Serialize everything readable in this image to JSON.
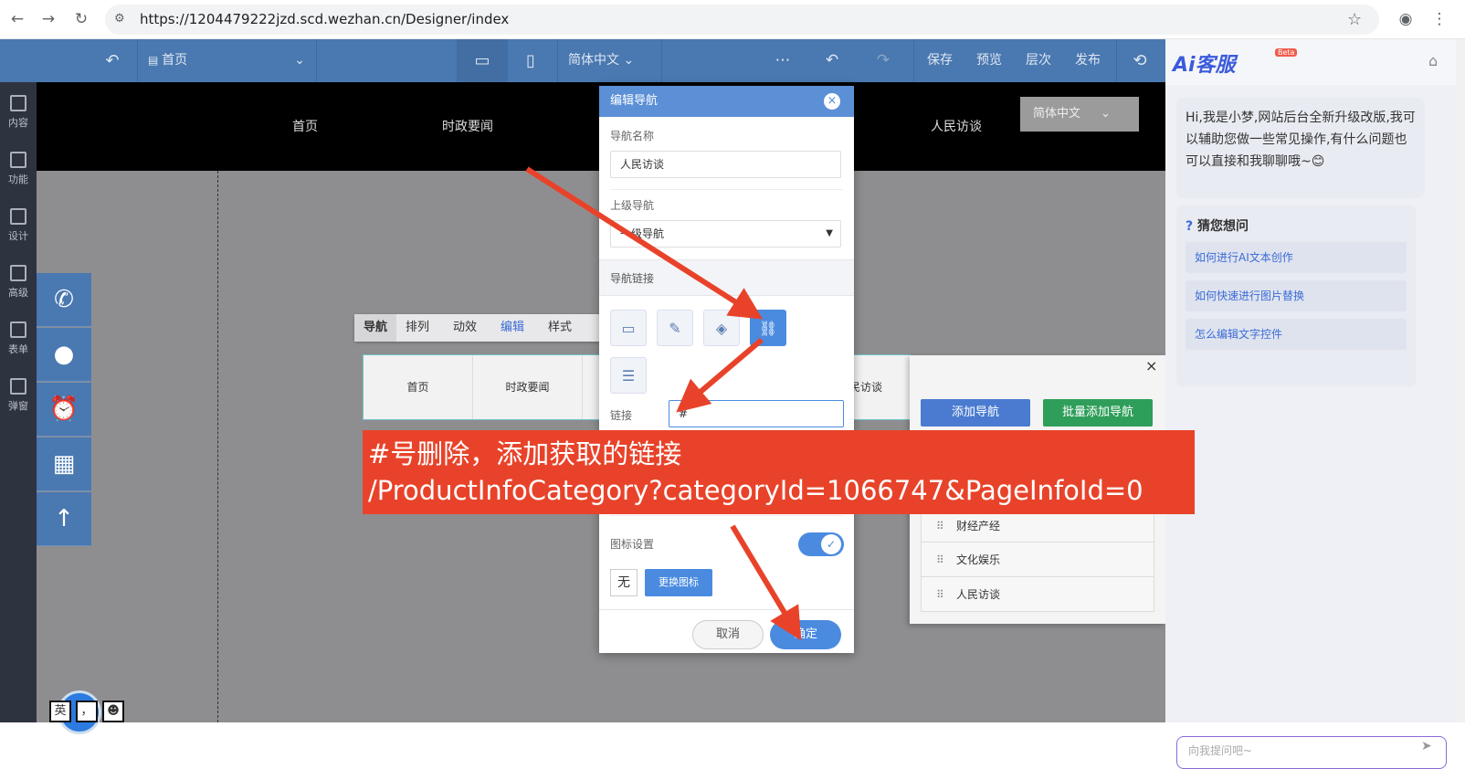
{
  "browser": {
    "url": "https://1204479222jzd.scd.wezhan.cn/Designer/index"
  },
  "toolbar": {
    "page_select": "首页",
    "lang_select": "简体中文",
    "save": "保存",
    "preview": "预览",
    "layers": "层次",
    "publish": "发布"
  },
  "sidebar": {
    "items": [
      {
        "label": "内容"
      },
      {
        "label": "功能"
      },
      {
        "label": "设计"
      },
      {
        "label": "高级"
      },
      {
        "label": "表单"
      },
      {
        "label": "弹窗"
      }
    ]
  },
  "site": {
    "nav": [
      "首页",
      "时政要闻",
      "人民访谈"
    ],
    "lang": "简体中文"
  },
  "minitoolbar": {
    "items": [
      "导航",
      "排列",
      "动效",
      "编辑",
      "样式"
    ]
  },
  "navcomp": {
    "items": [
      "首页",
      "时政要闻",
      "民访谈"
    ]
  },
  "navpanel": {
    "add_nav": "添加导航",
    "batch_add": "批量添加导航",
    "rows": [
      "财经产经",
      "文化娱乐",
      "人民访谈"
    ]
  },
  "dialog": {
    "title": "编辑导航",
    "name_label": "导航名称",
    "name_value": "人民访谈",
    "parent_label": "上级导航",
    "parent_value": "一级导航",
    "link_section": "导航链接",
    "link_label": "链接",
    "link_value": "#",
    "icon_label": "图标设置",
    "icon_none": "无",
    "icon_change": "更换图标",
    "cancel": "取消",
    "ok": "确定"
  },
  "annotation": {
    "line1": "#号删除，添加获取的链接",
    "line2": "/ProductInfoCategory?categoryId=1066747&PageInfoId=0"
  },
  "ai": {
    "logo": "Ai客服",
    "beta": "Beta",
    "greeting": "Hi,我是小梦,网站后台全新升级改版,我可以辅助您做一些常见操作,有什么问题也可以直接和我聊聊哦~😊",
    "guess_title": "猜您想问",
    "questions": [
      "如何进行AI文本创作",
      "如何快速进行图片替换",
      "怎么编辑文字控件"
    ],
    "input_placeholder": "向我提问吧~"
  },
  "bottom_left": {
    "chars": [
      "英",
      "，",
      "☻"
    ]
  },
  "colors": {
    "toolbar": "#4a78b0",
    "dialog_header": "#5b8fd6",
    "annotation": "#e8432a",
    "add_button": "#4a7bd0",
    "batch_button": "#2f9e5a"
  }
}
